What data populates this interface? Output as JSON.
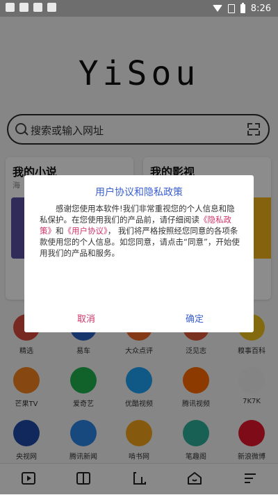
{
  "status_bar": {
    "time": "8:26"
  },
  "logo": "YiSou",
  "search": {
    "placeholder": "搜索或输入网址"
  },
  "cards": [
    {
      "title": "我的小说",
      "subtitle": "海"
    },
    {
      "title": "我的影视"
    }
  ],
  "apps": [
    {
      "label": "精选",
      "icon": "jingxuan-icon",
      "color": "#d94c3d"
    },
    {
      "label": "易车",
      "icon": "yiche-icon",
      "color": "#2b62c4"
    },
    {
      "label": "大众点评",
      "icon": "dianping-icon",
      "color": "#f06a2a"
    },
    {
      "label": "泛见志",
      "icon": "fanjianzhi-icon",
      "color": "#e05a3a"
    },
    {
      "label": "糗事百科",
      "icon": "qiushi-icon",
      "color": "#f1c21b"
    },
    {
      "label": "芒果TV",
      "icon": "mangotv-icon",
      "color": "#f58220"
    },
    {
      "label": "爱奇艺",
      "icon": "iqiyi-icon",
      "color": "#1fb24d"
    },
    {
      "label": "优酷视频",
      "icon": "youku-icon",
      "color": "#1ea1f2"
    },
    {
      "label": "腾讯视频",
      "icon": "tencent-video-icon",
      "color": "#ff6a00"
    },
    {
      "label": "7K7K",
      "icon": "7k7k-icon",
      "color": "#f0f0f0"
    },
    {
      "label": "央视网",
      "icon": "cctv-icon",
      "color": "#1f4aa8"
    },
    {
      "label": "腾讯新闻",
      "icon": "tencent-news-icon",
      "color": "#2a86e8"
    },
    {
      "label": "啃书网",
      "icon": "kenshu-icon",
      "color": "#f2a51c"
    },
    {
      "label": "笔趣阁",
      "icon": "biquge-icon",
      "color": "#2cae9a"
    },
    {
      "label": "新浪微博",
      "icon": "weibo-icon",
      "color": "#e6162d"
    }
  ],
  "dialog": {
    "title": "用户协议和隐私政策",
    "body_part1": "感谢您使用本软件!我们非常重视您的个人信息和隐私保护。在您使用我们的产品前，请仔细阅读",
    "privacy_link": "《隐私政策》",
    "body_part2": "和",
    "agreement_link": "《用户协议》",
    "body_part3": "，  我们将严格按照经您同意的各项条款使用您的个人信息。如您同意，请点击“同意”，开始使用我们的产品和服务。",
    "cancel_label": "取消",
    "confirm_label": "确定"
  },
  "colors": {
    "link": "#d0336a",
    "primary": "#3a5fd0"
  }
}
